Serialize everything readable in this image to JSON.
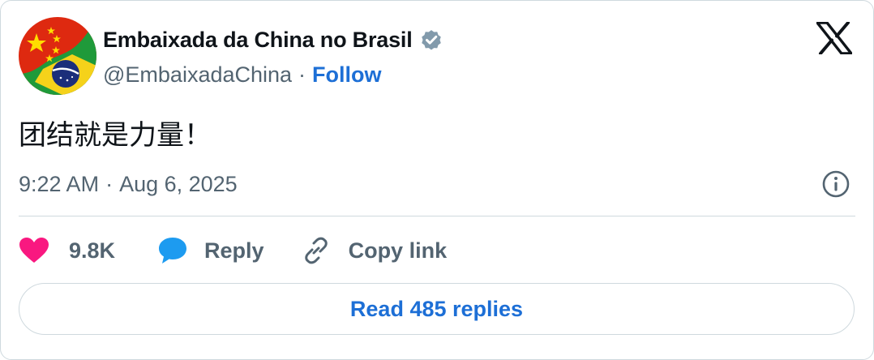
{
  "author": {
    "name": "Embaixada da China no Brasil",
    "handle": "@EmbaixadaChina",
    "separator": "·",
    "follow_label": "Follow",
    "verified": true,
    "avatar": "china-brazil-flags-avatar"
  },
  "tweet": {
    "text": "团结就是力量！",
    "time": "9:22 AM",
    "separator": "·",
    "date": "Aug 6, 2025"
  },
  "actions": {
    "likes_count": "9.8K",
    "reply_label": "Reply",
    "copy_link_label": "Copy link"
  },
  "read_replies_label": "Read 485 replies",
  "icons": {
    "logo": "x-logo-icon",
    "verified": "verified-badge-icon",
    "info": "info-icon",
    "like": "heart-icon",
    "reply": "chat-bubble-icon",
    "copy": "link-icon"
  },
  "colors": {
    "link_blue": "#1d6fd6",
    "heart_pink": "#f91880",
    "reply_blue": "#1d9bf0",
    "secondary_text": "#536471",
    "border": "#cfd9de"
  }
}
